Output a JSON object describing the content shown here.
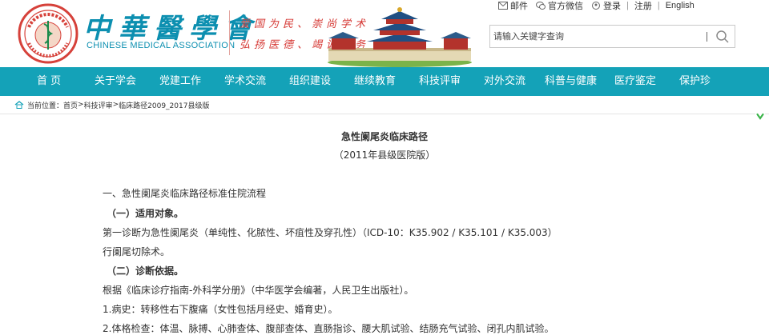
{
  "brand": {
    "seal_text": "中华医学会",
    "name_cn": "中華醫學會",
    "name_en": "CHINESE MEDICAL ASSOCIATION",
    "slogan_line1": "爱国为民、崇尚学术",
    "slogan_line2": "弘扬医德、竭诚服务"
  },
  "toplinks": {
    "mail": "邮件",
    "wechat": "官方微信",
    "login": "登录",
    "sep": "|",
    "register": "注册",
    "english": "English"
  },
  "search": {
    "placeholder": "请输入关键字查询"
  },
  "nav": [
    "首 页",
    "关于学会",
    "党建工作",
    "学术交流",
    "组织建设",
    "继续教育",
    "科技评审",
    "对外交流",
    "科普与健康",
    "医疗鉴定",
    "保护珍"
  ],
  "breadcrumb": {
    "label": "当前位置：",
    "home": "首页",
    "sep": ">",
    "level1": "科技评审",
    "level2": "临床路径2009_2017县级版"
  },
  "article": {
    "title": "急性阑尾炎临床路径",
    "subtitle": "（2011年县级医院版）",
    "lines": [
      "一、急性阑尾炎临床路径标准住院流程",
      "（一）适用对象。",
      "第一诊断为急性阑尾炎（单纯性、化脓性、坏疽性及穿孔性）（ICD-10：K35.902 / K35.101 / K35.003）",
      "行阑尾切除术。",
      "（二）诊断依据。",
      "根据《临床诊疗指南-外科学分册》（中华医学会编著，人民卫生出版社）。",
      "1.病史：转移性右下腹痛（女性包括月经史、婚育史）。",
      "2.体格检查：体温、脉搏、心肺查体、腹部查体、直肠指诊、腰大肌试验、结肠充气试验、闭孔内肌试验。"
    ]
  },
  "colors": {
    "brand_blue": "#0c8fb0",
    "nav_bg": "#14a2b8",
    "slogan_red": "#d63a36"
  }
}
